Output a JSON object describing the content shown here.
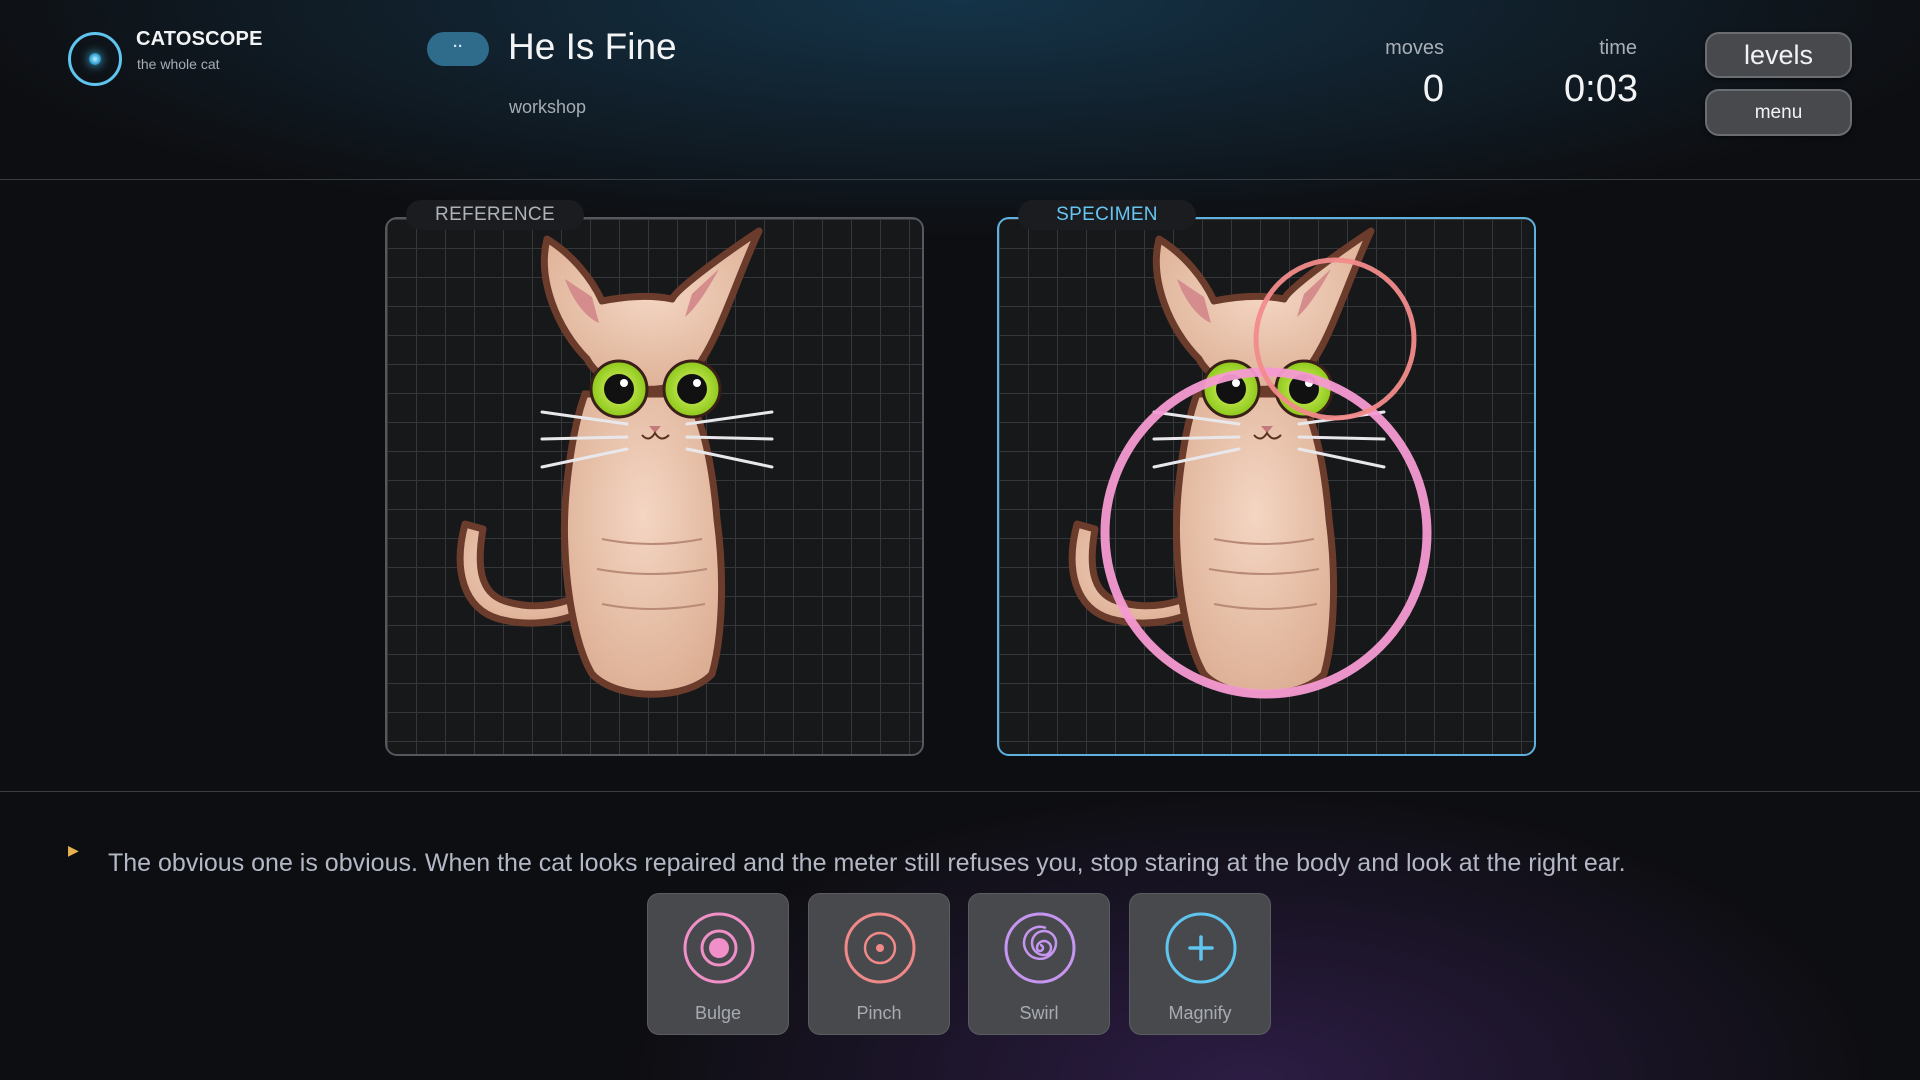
{
  "app": {
    "title": "CATOSCOPE",
    "subtitle": "the whole cat"
  },
  "level": {
    "badge": "··",
    "title": "He Is Fine",
    "subtitle": "workshop"
  },
  "stats": {
    "moves_label": "moves",
    "moves_value": "0",
    "time_label": "time",
    "time_value": "0:03"
  },
  "buttons": {
    "levels": "levels",
    "menu": "menu"
  },
  "panels": {
    "reference_label": "REFERENCE",
    "specimen_label": "SPECIMEN"
  },
  "hint": {
    "icon": "play-triangle-icon",
    "text": "The obvious one is obvious. When the cat looks repaired and the meter still refuses you, stop staring at the body and look at the right ear."
  },
  "tools": [
    {
      "label": "Bulge",
      "icon": "bulge-icon",
      "color": "#f08fc8"
    },
    {
      "label": "Pinch",
      "icon": "pinch-icon",
      "color": "#f08a8a"
    },
    {
      "label": "Swirl",
      "icon": "swirl-icon",
      "color": "#c596f0"
    },
    {
      "label": "Magnify",
      "icon": "magnify-icon",
      "color": "#5fc4ee"
    }
  ],
  "colors": {
    "accent": "#5fc4ee",
    "bulge": "#f59ad2",
    "pinch": "#f28b8b",
    "cat_fur": "#e8bfa6",
    "cat_outline": "#6b3b2b",
    "cat_eyes": "#a7e022"
  }
}
